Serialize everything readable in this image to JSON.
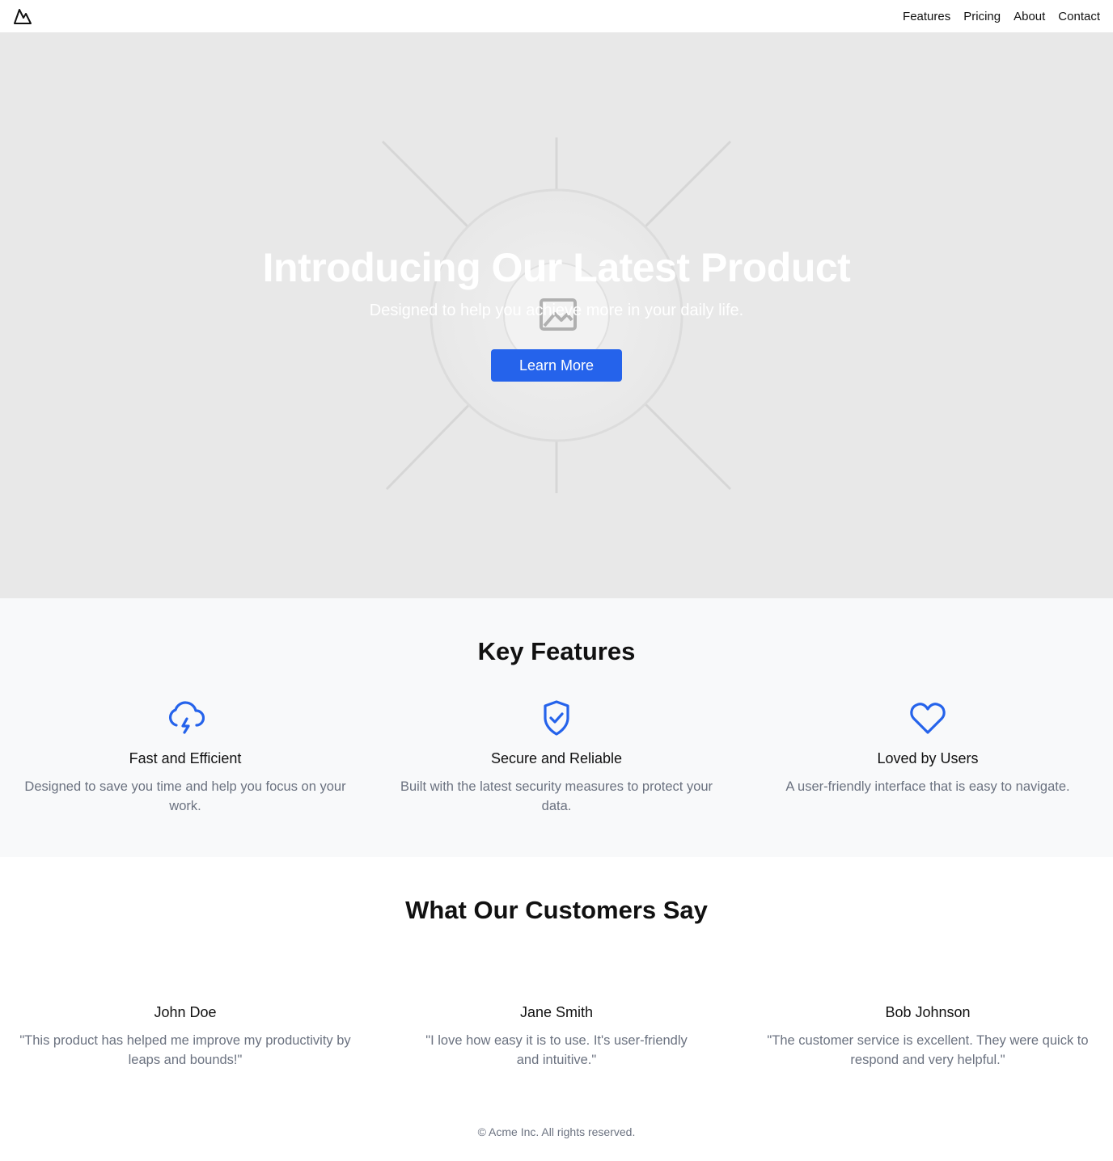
{
  "header": {
    "logo_icon": "mountain-icon",
    "nav": [
      {
        "label": "Features"
      },
      {
        "label": "Pricing"
      },
      {
        "label": "About"
      },
      {
        "label": "Contact"
      }
    ]
  },
  "hero": {
    "title": "Introducing Our Latest Product",
    "subtitle": "Designed to help you achieve more in your daily life.",
    "cta_label": "Learn More",
    "image_icon": "image-placeholder-icon",
    "background_color": "#e8e8e8"
  },
  "features": {
    "title": "Key Features",
    "items": [
      {
        "icon": "cloud-lightning-icon",
        "title": "Fast and Efficient",
        "description": "Designed to save you time and help you focus on your work."
      },
      {
        "icon": "shield-check-icon",
        "title": "Secure and Reliable",
        "description": "Built with the latest security measures to protect your data."
      },
      {
        "icon": "heart-icon",
        "title": "Loved by Users",
        "description": "A user-friendly interface that is easy to navigate."
      }
    ]
  },
  "testimonials": {
    "title": "What Our Customers Say",
    "items": [
      {
        "name": "John Doe",
        "quote": "\"This product has helped me improve my productivity by leaps and bounds!\""
      },
      {
        "name": "Jane Smith",
        "quote": "\"I love how easy it is to use. It's user-friendly and intuitive.\""
      },
      {
        "name": "Bob Johnson",
        "quote": "\"The customer service is excellent. They were quick to respond and very helpful.\""
      }
    ]
  },
  "footer": {
    "copyright": "© Acme Inc. All rights reserved."
  },
  "colors": {
    "accent": "#2563eb",
    "muted_text": "#6b7280",
    "features_bg": "#f8f9fa"
  }
}
